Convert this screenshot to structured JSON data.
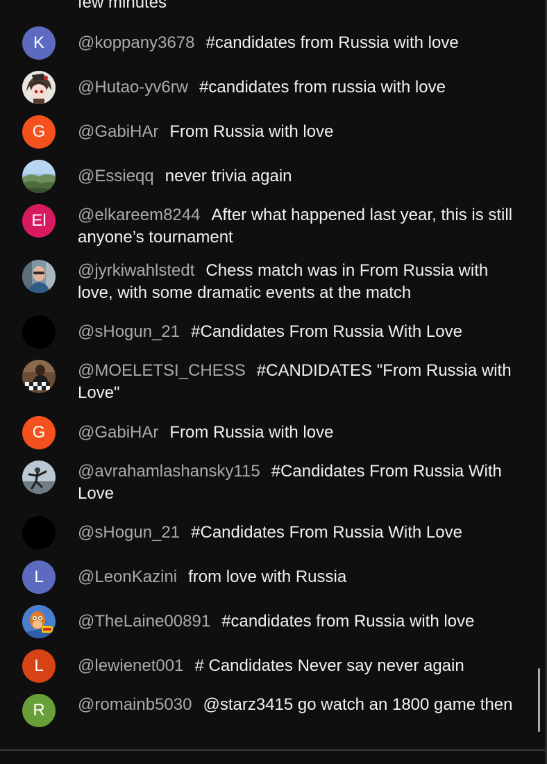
{
  "partial_message": "few minutes",
  "messages": [
    {
      "author": "@koppany3678",
      "text": "#candidates from Russia with love",
      "initial": "K",
      "color": "#5c6bc0"
    },
    {
      "author": "@Hutao-yv6rw",
      "text": "#candidates from russia with love",
      "avatar_icon": "anime-avatar-icon"
    },
    {
      "author": "@GabiHAr",
      "text": "From Russia with love",
      "initial": "G",
      "color": "#f4511e"
    },
    {
      "author": "@Essieqq",
      "text": "never trivia again",
      "avatar_icon": "landscape-avatar-icon"
    },
    {
      "author": "@elkareem8244",
      "text": "After what happened last year, this is still anyone’s tournament",
      "initial": "El",
      "color": "#d81b60"
    },
    {
      "author": "@jyrkiwahlstedt",
      "text": "Chess match was in From Russia with love, with some dramatic events at the match",
      "avatar_icon": "photo-avatar-icon"
    },
    {
      "author": "@sHogun_21",
      "text": "#Candidates From Russia With Love",
      "avatar_icon": "black-avatar-icon"
    },
    {
      "author": "@MOELETSI_CHESS",
      "text": "#CANDIDATES \"From Russia with Love\"",
      "avatar_icon": "chess-photo-avatar-icon"
    },
    {
      "author": "@GabiHAr",
      "text": "From Russia with love",
      "initial": "G",
      "color": "#f4511e"
    },
    {
      "author": "@avrahamlashansky115",
      "text": "#Candidates From Russia With Love",
      "avatar_icon": "dance-photo-avatar-icon"
    },
    {
      "author": "@sHogun_21",
      "text": "#Candidates From Russia With Love",
      "avatar_icon": "black-avatar-icon"
    },
    {
      "author": "@LeonKazini",
      "text": "from love with Russia",
      "initial": "L",
      "color": "#5c6bc0"
    },
    {
      "author": "@TheLaine00891",
      "text": "#candidates from Russia with love",
      "avatar_icon": "cartoon-avatar-icon"
    },
    {
      "author": "@lewienet001",
      "text": "# Candidates Never say never again",
      "initial": "L",
      "color": "#d84315"
    },
    {
      "author": "@romainb5030",
      "text": "@starz3415 go watch an 1800 game then",
      "initial": "R",
      "color": "#689f38"
    }
  ]
}
